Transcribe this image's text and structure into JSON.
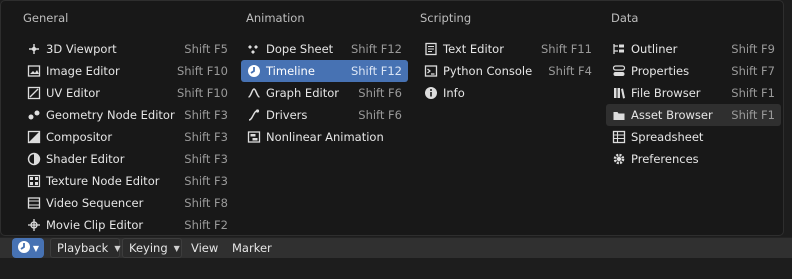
{
  "menu": {
    "columns": [
      {
        "title": "General",
        "items": [
          {
            "label": "3D Viewport",
            "shortcut": "Shift F5",
            "icon": "3d-viewport-icon"
          },
          {
            "label": "Image Editor",
            "shortcut": "Shift F10",
            "icon": "image-icon"
          },
          {
            "label": "UV Editor",
            "shortcut": "Shift F10",
            "icon": "uv-icon"
          },
          {
            "label": "Geometry Node Editor",
            "shortcut": "Shift F3",
            "icon": "geometry-nodes-icon"
          },
          {
            "label": "Compositor",
            "shortcut": "Shift F3",
            "icon": "compositor-icon"
          },
          {
            "label": "Shader Editor",
            "shortcut": "Shift F3",
            "icon": "shader-icon"
          },
          {
            "label": "Texture Node Editor",
            "shortcut": "Shift F3",
            "icon": "texture-icon"
          },
          {
            "label": "Video Sequencer",
            "shortcut": "Shift F8",
            "icon": "video-sequencer-icon"
          },
          {
            "label": "Movie Clip Editor",
            "shortcut": "Shift F2",
            "icon": "movie-clip-icon"
          }
        ]
      },
      {
        "title": "Animation",
        "items": [
          {
            "label": "Dope Sheet",
            "shortcut": "Shift F12",
            "icon": "dope-sheet-icon"
          },
          {
            "label": "Timeline",
            "shortcut": "Shift F12",
            "icon": "timeline-icon",
            "state": "active"
          },
          {
            "label": "Graph Editor",
            "shortcut": "Shift F6",
            "icon": "graph-icon"
          },
          {
            "label": "Drivers",
            "shortcut": "Shift F6",
            "icon": "drivers-icon"
          },
          {
            "label": "Nonlinear Animation",
            "shortcut": "",
            "icon": "nla-icon"
          }
        ]
      },
      {
        "title": "Scripting",
        "items": [
          {
            "label": "Text Editor",
            "shortcut": "Shift F11",
            "icon": "text-editor-icon"
          },
          {
            "label": "Python Console",
            "shortcut": "Shift F4",
            "icon": "console-icon"
          },
          {
            "label": "Info",
            "shortcut": "",
            "icon": "info-icon"
          }
        ]
      },
      {
        "title": "Data",
        "items": [
          {
            "label": "Outliner",
            "shortcut": "Shift F9",
            "icon": "outliner-icon"
          },
          {
            "label": "Properties",
            "shortcut": "Shift F7",
            "icon": "properties-icon"
          },
          {
            "label": "File Browser",
            "shortcut": "Shift F1",
            "icon": "file-browser-icon"
          },
          {
            "label": "Asset Browser",
            "shortcut": "Shift F1",
            "icon": "asset-browser-icon",
            "state": "hover"
          },
          {
            "label": "Spreadsheet",
            "shortcut": "",
            "icon": "spreadsheet-icon"
          },
          {
            "label": "Preferences",
            "shortcut": "",
            "icon": "preferences-icon"
          }
        ]
      }
    ]
  },
  "header": {
    "editor_type_icon": "timeline-icon",
    "playback_label": "Playback",
    "keying_label": "Keying",
    "view_label": "View",
    "marker_label": "Marker"
  },
  "colors": {
    "accent": "#4772b3",
    "menu_bg": "#181818",
    "hover_bg": "#2f2f2f"
  }
}
